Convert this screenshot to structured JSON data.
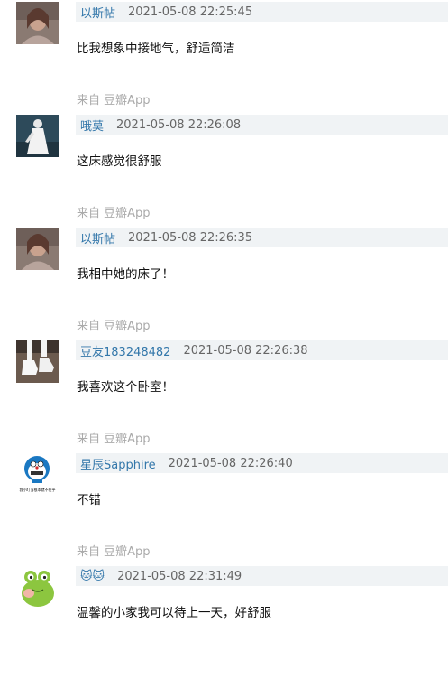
{
  "comments": [
    {
      "author": "以斯帖",
      "time": "2021-05-08 22:25:45",
      "text": "比我想象中接地气，舒适简洁",
      "source": "来自 豆瓣App",
      "avatar": "woman-portrait-avatar"
    },
    {
      "author": "哦莫",
      "time": "2021-05-08 22:26:08",
      "text": "这床感觉很舒服",
      "source": "来自 豆瓣App",
      "avatar": "white-dress-figure-avatar"
    },
    {
      "author": "以斯帖",
      "time": "2021-05-08 22:26:35",
      "text": "我相中她的床了！",
      "source": "来自 豆瓣App",
      "avatar": "woman-portrait-avatar"
    },
    {
      "author": "豆友183248482",
      "time": "2021-05-08 22:26:38",
      "text": "我喜欢这个卧室！",
      "source": "来自 豆瓣App",
      "avatar": "white-sneakers-avatar"
    },
    {
      "author": "星辰Sapphire",
      "time": "2021-05-08 22:26:40",
      "text": "不错",
      "source": "来自 豆瓣App",
      "avatar": "doraemon-meme-avatar",
      "avatar_caption": "我小叮当根本就不在乎"
    },
    {
      "author": "🐱🐱",
      "time": "2021-05-08 22:31:49",
      "text": "温馨的小家我可以待上一天，好舒服",
      "source": "",
      "avatar": "green-frog-avatar"
    }
  ],
  "colors": {
    "author": "#3377aa",
    "meta_bg": "#f0f3f5",
    "source": "#aaaaaa"
  }
}
